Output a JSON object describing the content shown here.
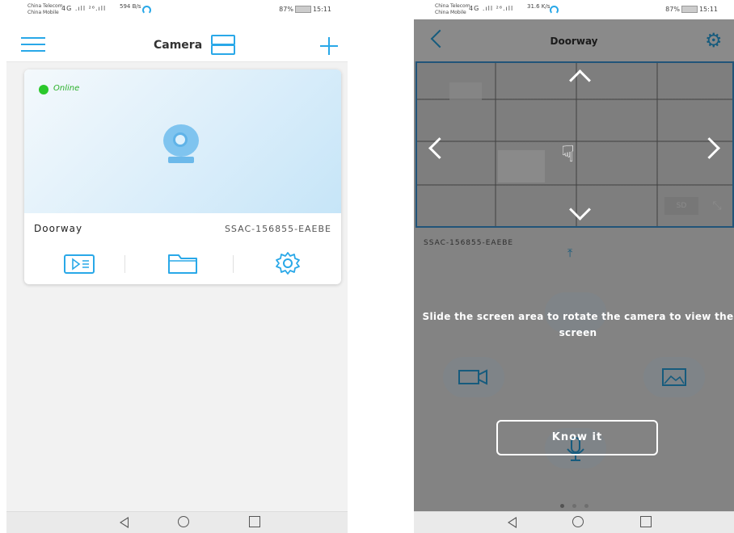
{
  "left": {
    "status_bar": {
      "carrier_1": "China Telecom",
      "carrier_2": "China Mobile",
      "signal": "4G .ıll ²⁶.ıll",
      "speed": "594 B/s",
      "battery": "87%",
      "time": "15:11"
    },
    "header": {
      "title": "Camera"
    },
    "device": {
      "status": "Online",
      "name": "Doorway",
      "id": "SSAC-156855-EAEBE"
    },
    "icons": {
      "menu": "menu-icon",
      "layout": "layout-toggle-icon",
      "add": "plus-icon",
      "playback": "playback-icon",
      "files": "folder-icon",
      "settings": "gear-icon"
    },
    "colors": {
      "accent": "#29a8e8",
      "online": "#2bc82b"
    }
  },
  "right": {
    "status_bar": {
      "carrier_1": "China Telecom",
      "carrier_2": "China Mobile",
      "signal": "4G .ıll ²⁶.ıll",
      "speed": "31.6 K/s",
      "battery": "87%",
      "time": "15:11"
    },
    "header": {
      "title": "Doorway"
    },
    "video": {
      "quality": "SD",
      "fullscreen_glyph": "⤡"
    },
    "device_id": "SSAC-156855-EAEBE",
    "guide": {
      "hint": "Slide the screen area to rotate the camera to view the screen",
      "button": "Know it"
    },
    "icons": {
      "back": "back-chevron-icon",
      "settings": "gear-icon",
      "pin": "pin-top-icon",
      "record": "video-record-icon",
      "snapshot": "snapshot-icon",
      "mic": "microphone-icon",
      "hand": "hand-swipe-icon"
    }
  },
  "navigation": {
    "back": "◁",
    "home": "○",
    "recent": "□"
  }
}
